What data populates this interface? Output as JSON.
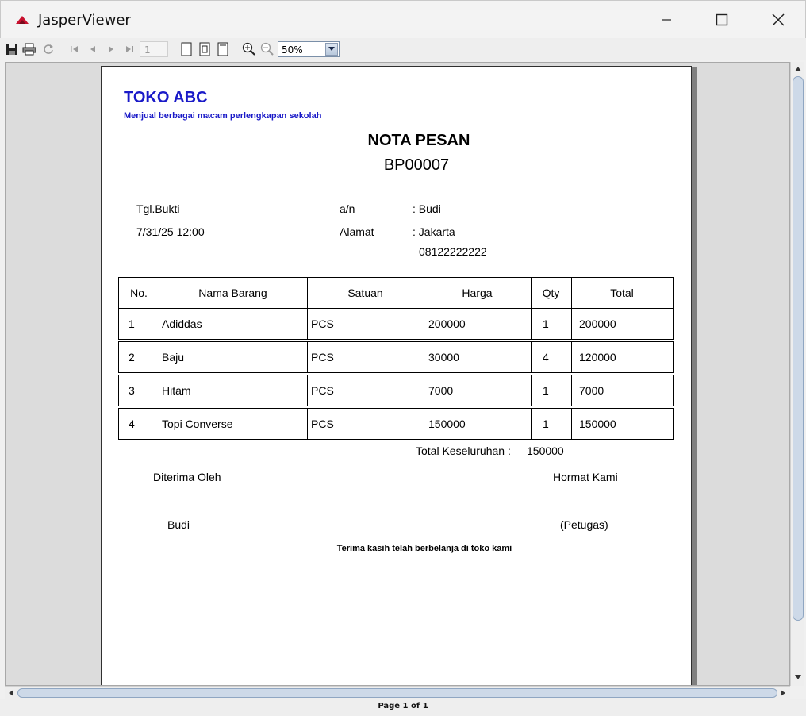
{
  "window": {
    "title": "JasperViewer"
  },
  "toolbar": {
    "page_number": "1",
    "zoom": "50%"
  },
  "report": {
    "store_name": "TOKO ABC",
    "tagline": "Menjual berbagai macam perlengkapan sekolah",
    "title": "NOTA PESAN",
    "number": "BP00007",
    "date_label": "Tgl.Bukti",
    "date_value": "7/31/25 12:00",
    "an_label": "a/n",
    "an_value": ": Budi",
    "alamat_label": "Alamat",
    "alamat_value": ": Jakarta",
    "phone": "08122222222",
    "columns": [
      "No.",
      "Nama Barang",
      "Satuan",
      "Harga",
      "Qty",
      "Total"
    ],
    "rows": [
      {
        "no": "1",
        "nama": "Adiddas",
        "satuan": "PCS",
        "harga": "200000",
        "qty": "1",
        "total": "200000"
      },
      {
        "no": "2",
        "nama": "Baju",
        "satuan": "PCS",
        "harga": "30000",
        "qty": "4",
        "total": "120000"
      },
      {
        "no": "3",
        "nama": "Hitam",
        "satuan": "PCS",
        "harga": "7000",
        "qty": "1",
        "total": "7000"
      },
      {
        "no": "4",
        "nama": "Topi Converse",
        "satuan": "PCS",
        "harga": "150000",
        "qty": "1",
        "total": "150000"
      }
    ],
    "grand_total_label": "Total Keseluruhan :",
    "grand_total_value": "150000",
    "received_by_label": "Diterima Oleh",
    "regards_label": "Hormat Kami",
    "received_by_name": "Budi",
    "regards_name": "(Petugas)",
    "thanks": "Terima kasih telah berbelanja di toko kami"
  },
  "status": {
    "page_info": "Page 1 of 1"
  }
}
